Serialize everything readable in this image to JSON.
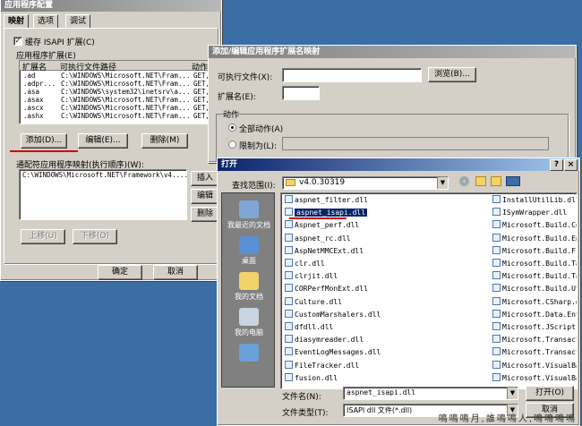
{
  "main_dialog": {
    "title": "应用程序配置",
    "tabs": [
      "映射",
      "选项",
      "调试"
    ],
    "cache_label": "缓存 ISAPI 扩展(C)",
    "ext_group": "应用程序扩展(E)",
    "columns": [
      "扩展名",
      "可执行文件路径",
      "动作"
    ],
    "rows": [
      [
        ".ad",
        "C:\\WINDOWS\\Microsoft.NET\\Fram...",
        "GET,"
      ],
      [
        ".adpr...",
        "C:\\WINDOWS\\Microsoft.NET\\Fram...",
        "GET,"
      ],
      [
        ".asa",
        "C:\\WINDOWS\\system32\\inetsrv\\a...",
        "GET,"
      ],
      [
        ".asax",
        "C:\\WINDOWS\\Microsoft.NET\\Fram...",
        "GET,"
      ],
      [
        ".ascx",
        "C:\\WINDOWS\\Microsoft.NET\\Fram...",
        "GET,"
      ],
      [
        ".ashx",
        "C:\\WINDOWS\\Microsoft.NET\\Fram...",
        "GET,"
      ]
    ],
    "add": "添加(D)...",
    "edit": "编辑(E)...",
    "delete": "删除(M)",
    "wildcard_label": "通配符应用程序映射(执行顺序)(W):",
    "wildcard_row": "C:\\WINDOWS\\Microsoft.NET\\Framework\\v4....",
    "insert": "插入",
    "edit2": "编辑",
    "delete2": "删除",
    "move_up": "上移(U)",
    "move_down": "下移(O)",
    "ok": "确定",
    "cancel": "取消"
  },
  "edit_dialog": {
    "title": "添加/编辑应用程序扩展名映射",
    "exe_label": "可执行文件(X):",
    "browse": "浏览(B)...",
    "ext_label": "扩展名(E):",
    "verbs_group": "动作",
    "all_verbs": "全部动作(A)",
    "limit_to": "限制为(L):"
  },
  "open_dialog": {
    "title": "打开",
    "lookin_label": "查找范围(I):",
    "lookin_value": "v4.0.30319",
    "places": [
      "我最近的文档",
      "桌面",
      "我的文档",
      "我的电脑",
      ""
    ],
    "files_col1": [
      "aspnet_filter.dll",
      "aspnet_isapi.dll",
      "Aspnet_perf.dll",
      "aspnet_rc.dll",
      "AspNetMMCExt.dll",
      "clr.dll",
      "clrjit.dll",
      "CORPerfMonExt.dll",
      "Culture.dll",
      "CustomMarshalers.dll",
      "dfdll.dll",
      "diasymreader.dll",
      "EventLogMessages.dll",
      "FileTracker.dll",
      "fusion.dll"
    ],
    "files_col2": [
      "InstallUtilLib.dll",
      "ISymWrapper.dll",
      "Microsoft.Build.Co",
      "Microsoft.Build.En",
      "Microsoft.Build.Fr",
      "Microsoft.Build.Ta",
      "Microsoft.Build.Ta",
      "Microsoft.Build.Ut",
      "Microsoft.CSharp.d",
      "Microsoft.Data.Ent",
      "Microsoft.JScript.",
      "Microsoft.Transact",
      "Microsoft.Transact",
      "Microsoft.VisualBa",
      "Microsoft.VisualBa"
    ],
    "filename_label": "文件名(N):",
    "filename_value": "aspnet_isapi.dll",
    "filetype_label": "文件类型(T):",
    "filetype_value": "ISAPI dll 文件(*.dll)",
    "open": "打开(O)",
    "cancel": "取消"
  },
  "watermark": "鳴鳴鳴月,誰鳴鳴人,鳴鳴鳴鳴",
  "colors": {
    "titlebar_active": "#0a246a",
    "selection": "#0a246a",
    "underline": "#cc0000"
  }
}
